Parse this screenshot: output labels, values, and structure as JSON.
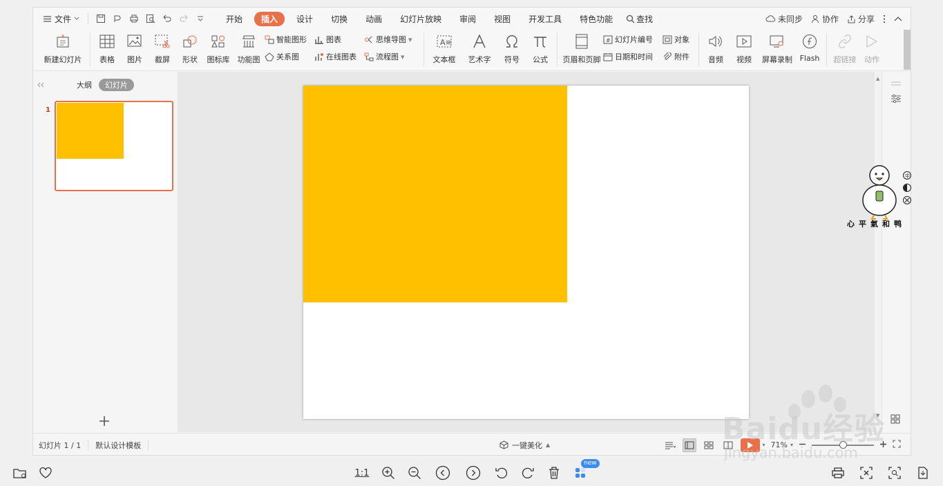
{
  "menubar": {
    "file_label": "文件",
    "tabs": [
      "开始",
      "插入",
      "设计",
      "切换",
      "动画",
      "幻灯片放映",
      "审阅",
      "视图",
      "开发工具",
      "特色功能"
    ],
    "active_tab": "插入",
    "search_label": "查找",
    "sync_label": "未同步",
    "collab_label": "协作",
    "share_label": "分享"
  },
  "ribbon": {
    "new_slide": "新建幻灯片",
    "table": "表格",
    "picture": "图片",
    "screenshot": "截屏",
    "shape": "形状",
    "icon_lib": "图标库",
    "func_chart": "功能图",
    "smart_shape": "智能图形",
    "chart": "图表",
    "relation": "关系图",
    "online_chart": "在线图表",
    "mindmap": "思维导图",
    "flowchart": "流程图",
    "textbox": "文本框",
    "wordart": "艺术字",
    "symbol": "符号",
    "formula": "公式",
    "header_footer": "页眉和页脚",
    "slide_number": "幻灯片编号",
    "object": "对象",
    "datetime": "日期和时间",
    "attachment": "附件",
    "audio": "音频",
    "video": "视频",
    "screen_record": "屏幕录制",
    "flash": "Flash",
    "hyperlink": "超链接",
    "action": "动作"
  },
  "leftpanel": {
    "outline_tab": "大纲",
    "slides_tab": "幻灯片",
    "slide_number": "1"
  },
  "statusbar": {
    "slide_info": "幻灯片 1 / 1",
    "template": "默认设计模板",
    "beautify": "一键美化",
    "zoom": "71%"
  },
  "bottombar": {
    "ratio_label": "1:1",
    "new_badge": "new"
  },
  "watermark": {
    "duck_caption": "心平氣和鸭",
    "baidu_brand": "Baidu经验",
    "baidu_url": "jingyan.baidu.com"
  },
  "colors": {
    "accent": "#e8704a",
    "shape_fill": "#ffc000"
  }
}
